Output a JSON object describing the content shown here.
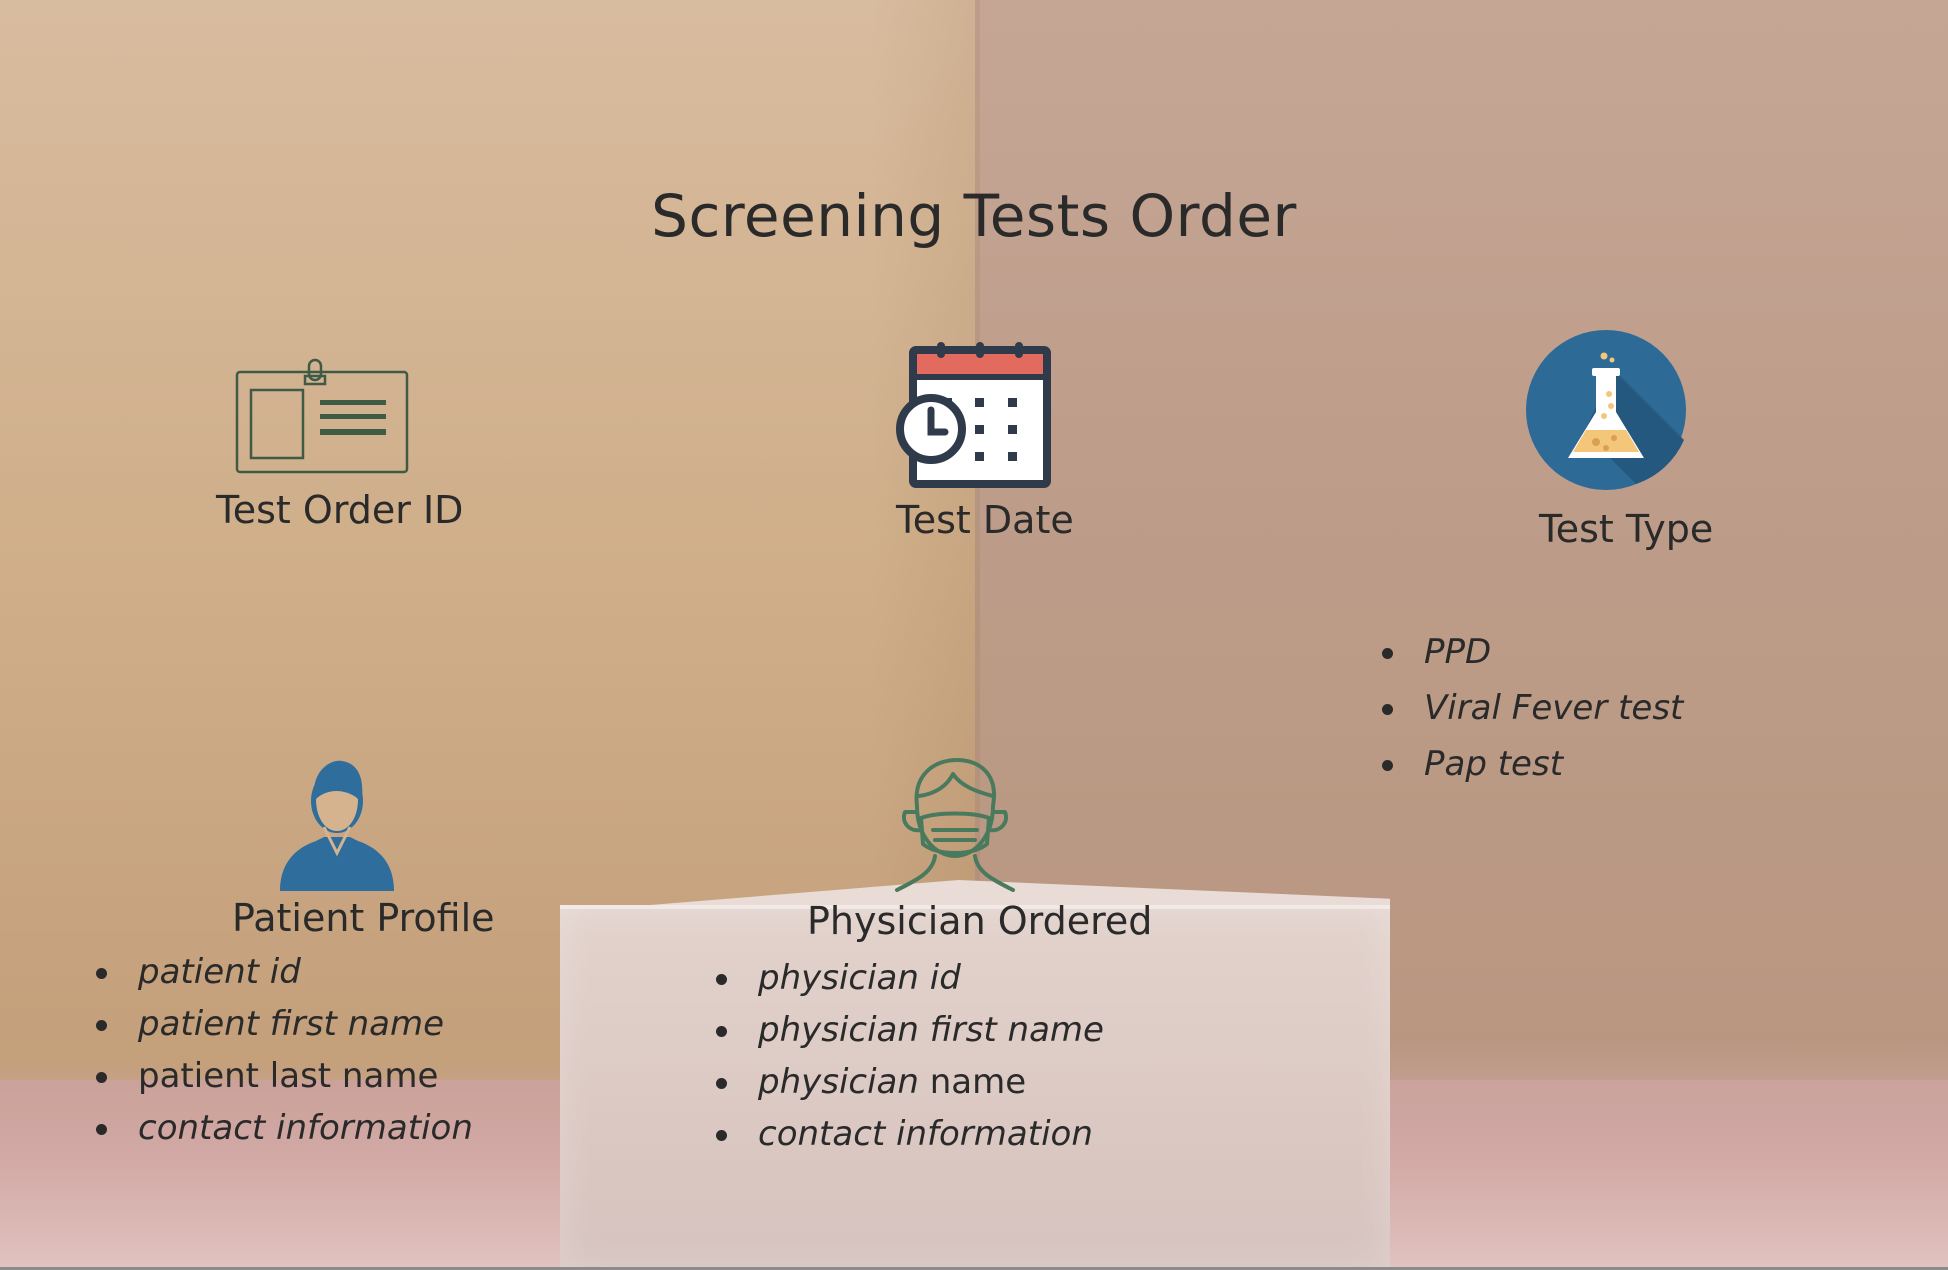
{
  "title": "Screening Tests Order",
  "nodes": {
    "test_order_id": {
      "label": "Test Order ID",
      "icon": "id-card-icon"
    },
    "test_date": {
      "label": "Test Date",
      "icon": "calendar-clock-icon"
    },
    "test_type": {
      "label": "Test Type",
      "icon": "lab-flask-icon",
      "items": [
        "PPD",
        "Viral Fever test",
        "Pap test"
      ]
    },
    "patient_profile": {
      "label": "Patient Profile",
      "icon": "patient-person-icon",
      "items": [
        "patient id",
        "patient first name",
        "patient last name",
        "contact information"
      ]
    },
    "physician_ordered": {
      "label": "Physician Ordered",
      "icon": "masked-physician-icon",
      "items": [
        "physician id",
        "physician first name",
        "physician",
        "name",
        "contact information"
      ]
    }
  },
  "colors": {
    "icon_blue": "#2e6d9c",
    "flask_circle": "#2d6a96",
    "calendar_red": "#e36a5f",
    "icon_dark": "#2f3b4a",
    "mask_green": "#4a7a5e",
    "id_card_green": "#3f5a45"
  }
}
